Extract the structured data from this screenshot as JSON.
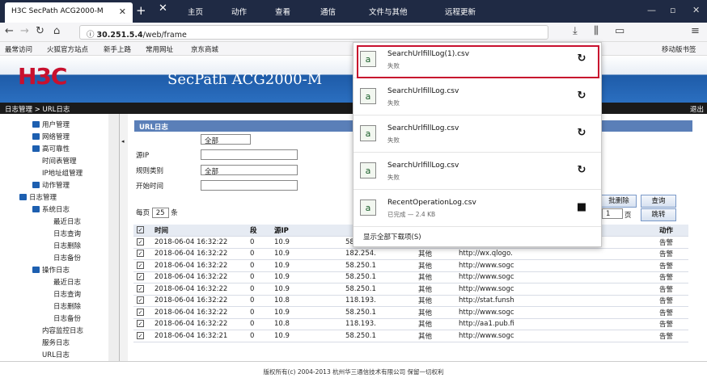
{
  "browser": {
    "tab_title": "H3C SecPath ACG2000-M",
    "toolbar_items": [
      "主页",
      "动作",
      "查看",
      "通信",
      "文件与其他",
      "远程更新"
    ],
    "url_prefix": "30.251.5.4",
    "url_path": "/web/frame",
    "bookmarks": [
      "最常访问",
      "火狐官方站点",
      "新手上路",
      "常用网址",
      "京东商城"
    ],
    "mobile_bookmarks": "移动版书签"
  },
  "app": {
    "logo": "H3C",
    "product": "SecPath ACG2000-M",
    "breadcrumb": "日志管理 > URL日志",
    "logout": "退出",
    "footer": "版权所有(c) 2004-2013 杭州华三通信技术有限公司 保留一切权利"
  },
  "sidebar": {
    "items": [
      "用户管理",
      "网络管理",
      "高可靠性",
      "时间表管理",
      "IP地址组管理",
      "动作管理",
      "日志管理",
      "系统日志",
      "最近日志",
      "日志查询",
      "日志删除",
      "日志备份",
      "操作日志",
      "最近日志",
      "日志查询",
      "日志删除",
      "日志备份",
      "内容监控日志",
      "服务日志",
      "URL日志"
    ]
  },
  "form": {
    "section_title": "URL日志",
    "all_option": "全部",
    "source_ip_label": "源IP",
    "rule_label": "规则类别",
    "rule_value": "全部",
    "start_time_label": "开始时间",
    "page_size_prefix": "每页",
    "page_size": "25",
    "page_size_suffix": "条",
    "btn_delete": "批删除",
    "btn_query": "查询",
    "page_num": "1",
    "page_suffix": "页",
    "btn_jump": "跳转"
  },
  "table": {
    "headers": [
      "时间",
      "段",
      "源IP",
      "",
      "",
      "",
      "动作"
    ],
    "rows": [
      [
        "2018-06-04 16:32:22",
        "0",
        "10.9",
        "58.",
        "",
        "",
        "告警"
      ],
      [
        "2018-06-04 16:32:22",
        "0",
        "10.9",
        "182.254.",
        "其他",
        "http://wx.qlogo.",
        "告警"
      ],
      [
        "2018-06-04 16:32:22",
        "0",
        "10.9",
        "58.250.1",
        "其他",
        "http://www.sogc",
        "告警"
      ],
      [
        "2018-06-04 16:32:22",
        "0",
        "10.9",
        "58.250.1",
        "其他",
        "http://www.sogc",
        "告警"
      ],
      [
        "2018-06-04 16:32:22",
        "0",
        "10.9",
        "58.250.1",
        "其他",
        "http://www.sogc",
        "告警"
      ],
      [
        "2018-06-04 16:32:22",
        "0",
        "10.8",
        "118.193.",
        "其他",
        "http://stat.funsh",
        "告警"
      ],
      [
        "2018-06-04 16:32:22",
        "0",
        "10.9",
        "58.250.1",
        "其他",
        "http://www.sogc",
        "告警"
      ],
      [
        "2018-06-04 16:32:22",
        "0",
        "10.8",
        "118.193.",
        "其他",
        "http://aa1.pub.fi",
        "告警"
      ],
      [
        "2018-06-04 16:32:21",
        "0",
        "10.9",
        "58.250.1",
        "其他",
        "http://www.sogc",
        "告警"
      ]
    ]
  },
  "downloads": {
    "items": [
      {
        "name": "SearchUrlfillLog(1).csv",
        "status": "失败"
      },
      {
        "name": "SearchUrlfillLog.csv",
        "status": "失败"
      },
      {
        "name": "SearchUrlfillLog.csv",
        "status": "失败"
      },
      {
        "name": "SearchUrlfillLog.csv",
        "status": "失败"
      },
      {
        "name": "RecentOperationLog.csv",
        "status": "已完成 — 2.4 KB"
      }
    ],
    "show_all": "显示全部下载项(S)"
  }
}
